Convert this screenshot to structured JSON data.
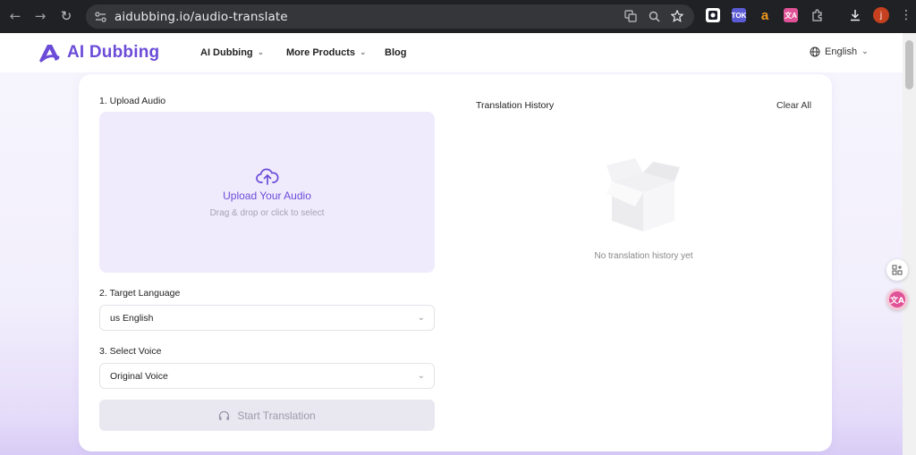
{
  "browser": {
    "url": "aidubbing.io/audio-translate",
    "back_glyph": "←",
    "forward_glyph": "→",
    "reload_glyph": "↻",
    "profile_initial": "j",
    "ext_tok_label": "TOK",
    "ext_a_label": "a",
    "ext_trans_label": "文A"
  },
  "header": {
    "logo_text": "AI Dubbing",
    "nav": [
      {
        "label": "AI Dubbing",
        "has_dropdown": true
      },
      {
        "label": "More Products",
        "has_dropdown": true
      },
      {
        "label": "Blog",
        "has_dropdown": false
      }
    ],
    "language": "English"
  },
  "upload": {
    "step_label": "1. Upload Audio",
    "title": "Upload Your Audio",
    "subtitle": "Drag & drop or click to select"
  },
  "target_language": {
    "step_label": "2. Target Language",
    "selected": "us English"
  },
  "voice": {
    "step_label": "3. Select Voice",
    "selected": "Original Voice"
  },
  "start_button": {
    "label": "Start Translation",
    "enabled": false
  },
  "history": {
    "title": "Translation History",
    "clear_label": "Clear All",
    "empty_text": "No translation history yet"
  },
  "colors": {
    "brand": "#6b4cd8",
    "upload_bg": "#efebfd",
    "button_disabled_bg": "#e9e8f0"
  }
}
